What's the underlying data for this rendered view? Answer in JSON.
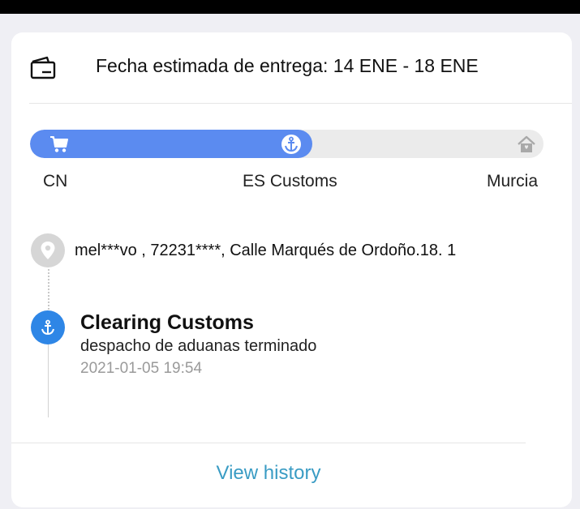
{
  "delivery": {
    "text": "Fecha estimada de entrega: 14 ENE - 18 ENE",
    "icon": "wallet-icon"
  },
  "progress": {
    "fraction": 0.55,
    "fill_color": "#5b8bf0",
    "steps": [
      {
        "label": "CN",
        "icon": "cart-icon",
        "done": true
      },
      {
        "label": "ES Customs",
        "icon": "anchor-icon",
        "done": true
      },
      {
        "label": "Murcia",
        "icon": "home-icon",
        "done": false
      }
    ]
  },
  "address": {
    "text": "mel***vo ,  72231****,  Calle Marqués de Ordoño.18. 1",
    "icon": "location-pin-icon"
  },
  "latest_event": {
    "title": "Clearing Customs",
    "description": "despacho de aduanas terminado",
    "timestamp": "2021-01-05 19:54",
    "icon": "anchor-icon",
    "color": "#2e86e6"
  },
  "history_link": "View history"
}
